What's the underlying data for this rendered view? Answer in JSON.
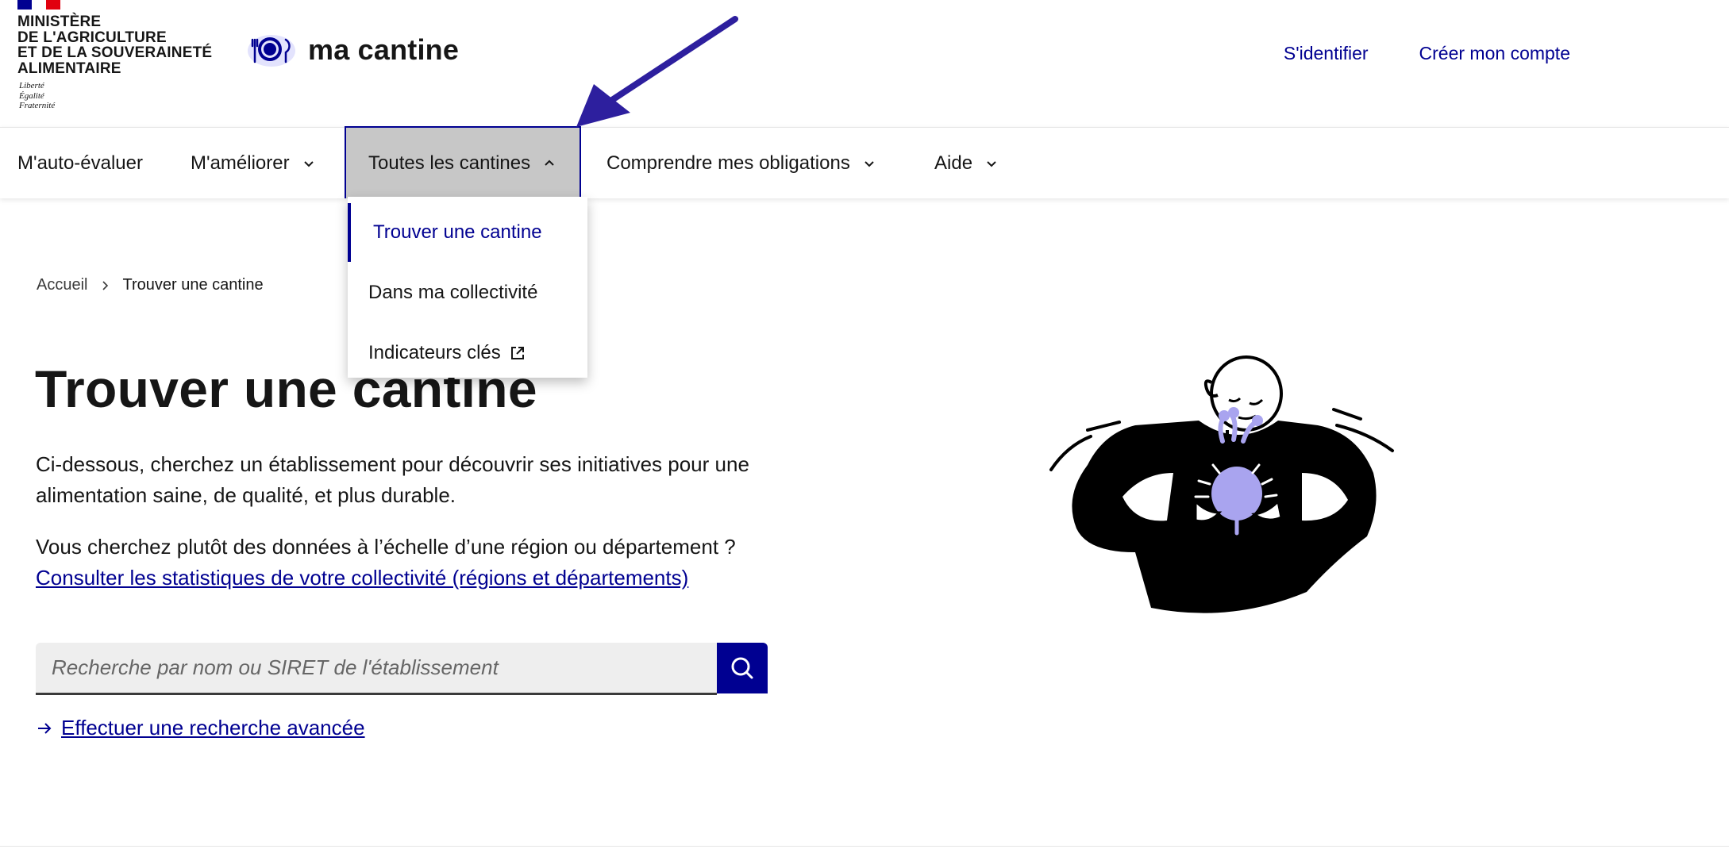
{
  "header": {
    "flag_colors": [
      "#000091",
      "#ffffff",
      "#e1000f"
    ],
    "ministry_lines": [
      "Ministère",
      "de l'Agriculture",
      "et de la Souveraineté",
      "Alimentaire"
    ],
    "devise": [
      "Liberté",
      "Égalité",
      "Fraternité"
    ],
    "site_name": "ma cantine",
    "logo_icon": "plate-logo-icon",
    "links": {
      "login": "S'identifier",
      "register": "Créer mon compte"
    }
  },
  "nav": {
    "items": [
      {
        "label": "M'auto-évaluer"
      },
      {
        "label": "M'améliorer"
      },
      {
        "label": "Toutes les cantines"
      },
      {
        "label": "Comprendre mes obligations"
      },
      {
        "label": "Aide"
      }
    ],
    "dropdown": [
      {
        "label": "Trouver une cantine"
      },
      {
        "label": "Dans ma collectivité"
      },
      {
        "label": "Indicateurs clés"
      }
    ]
  },
  "breadcrumb": {
    "home": "Accueil",
    "current": "Trouver une cantine"
  },
  "main": {
    "title": "Trouver une cantine",
    "intro": "Ci-dessous, cherchez un établissement pour découvrir ses initiatives pour une alimentation saine, de qualité, et plus durable.",
    "question": "Vous cherchez plutôt des données à l’échelle d’une région ou département ?",
    "stats_link": "Consulter les statistiques de votre collectivité (régions et départements)",
    "search_placeholder": "Recherche par nom ou SIRET de l'établissement",
    "advanced_search": "Effectuer une recherche avancée"
  },
  "colors": {
    "accent": "#000091",
    "active_tab_bg": "#c7c7c7",
    "illustration_accent": "#a9a4ef",
    "annotation_arrow": "#2d1f9e"
  }
}
